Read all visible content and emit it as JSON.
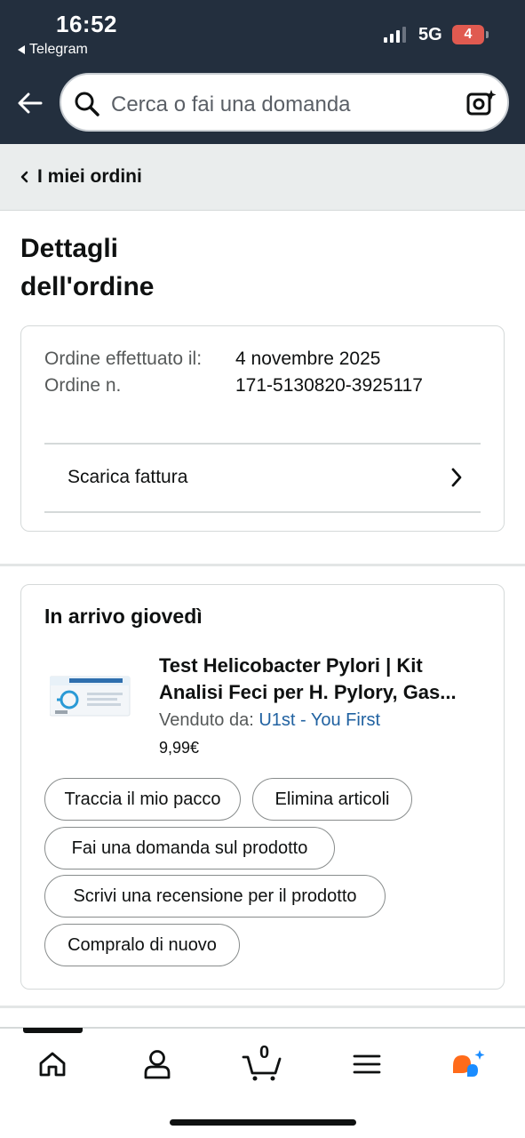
{
  "status_bar": {
    "time": "16:52",
    "back_app": "Telegram",
    "network": "5G",
    "battery": "4"
  },
  "header": {
    "search_placeholder": "Cerca o fai una domanda",
    "icons": [
      "back-arrow-icon",
      "search-icon",
      "camera-sparkle-icon"
    ]
  },
  "breadcrumb": {
    "label": "I miei ordini"
  },
  "page": {
    "title": "Dettagli dell'ordine"
  },
  "order_summary": {
    "date_label": "Ordine effettuato il:",
    "date_value": "4 novembre 2025",
    "number_label": "Ordine n.",
    "number_value": "171-5130820-3925117",
    "invoice_label": "Scarica fattura"
  },
  "shipment": {
    "arrival": "In arrivo giovedì",
    "product_title": "Test Helicobacter Pylori | Kit Analisi Feci per H. Pylory, Gas...",
    "sold_by_label": "Venduto da:",
    "seller": "U1st - You First",
    "price": "9,99€",
    "actions": {
      "track": "Traccia il mio pacco",
      "delete": "Elimina articoli",
      "question": "Fai una domanda sul prodotto",
      "review": "Scrivi una recensione per il prodotto",
      "buy_again": "Compralo di nuovo"
    }
  },
  "bottom_nav": {
    "cart_count": "0",
    "icons": [
      "home-icon",
      "account-icon",
      "cart-icon",
      "menu-icon",
      "rufus-icon"
    ]
  },
  "colors": {
    "header_bg": "#232f3e",
    "link": "#2162a1",
    "accent_orange": "#ff6b1a",
    "accent_blue": "#1a8cff"
  }
}
